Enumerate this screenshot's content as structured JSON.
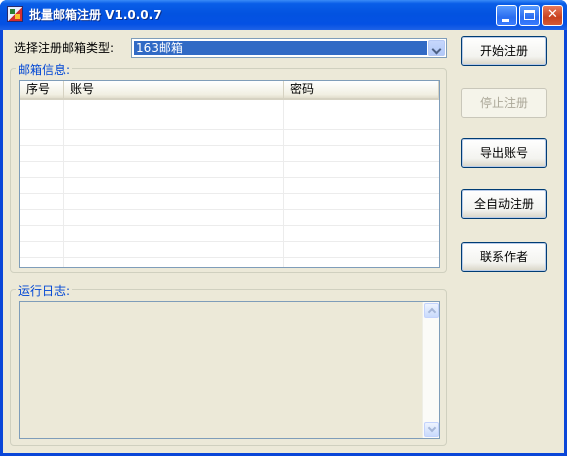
{
  "window": {
    "title": "批量邮箱注册 V1.0.0.7"
  },
  "form": {
    "type_label": "选择注册邮箱类型:",
    "type_selected": "163邮箱"
  },
  "info_group": {
    "legend": "邮箱信息:",
    "columns": [
      "序号",
      "账号",
      "密码"
    ],
    "rows": []
  },
  "log_group": {
    "legend": "运行日志:",
    "text": ""
  },
  "buttons": {
    "start": "开始注册",
    "stop": "停止注册",
    "export": "导出账号",
    "auto": "全自动注册",
    "contact": "联系作者"
  },
  "colors": {
    "title_bar": "#0353e0",
    "client_bg": "#ece9d8",
    "legend": "#0046d5",
    "selection": "#316ac5",
    "close_button": "#c8421f"
  },
  "icons": {
    "app": "app-icon",
    "minimize": "minimize-icon",
    "maximize": "maximize-icon",
    "close": "close-icon",
    "dropdown": "chevron-down-icon"
  }
}
